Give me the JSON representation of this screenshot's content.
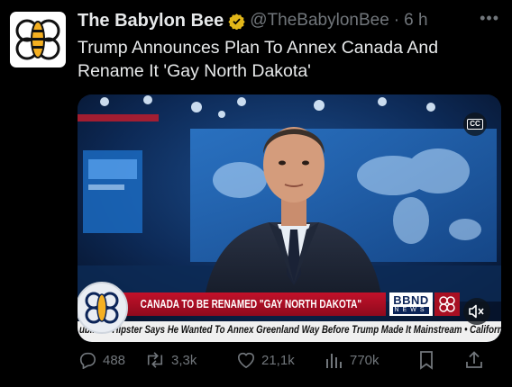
{
  "post": {
    "author_name": "The Babylon Bee",
    "handle": "@TheBabylonBee",
    "separator": "·",
    "time": "6 h",
    "text": "Trump Announces Plan To Annex Canada And Rename It 'Gay North Dakota'",
    "more_icon": "more-dots-icon"
  },
  "media": {
    "cc_label": "CC",
    "headline": "CANADA TO BE RENAMED \"GAY NORTH DAKOTA\"",
    "network": "BBND",
    "network_sub": "NEWS",
    "ticker": "ublican Hipster Says He Wanted To Annex Greenland Way Before Trump Made It Mainstream • California Police Arrest Arson",
    "mute_icon": "speaker-muted-icon",
    "colors": {
      "lower_third": "#c2112a",
      "network_blue": "#0b2458",
      "bee_yellow": "#f5b021"
    }
  },
  "actions": {
    "replies": "488",
    "reposts": "3,3k",
    "likes": "21,1k",
    "views": "770k"
  },
  "colors": {
    "muted": "#71767b",
    "verified": "#e2b719"
  }
}
